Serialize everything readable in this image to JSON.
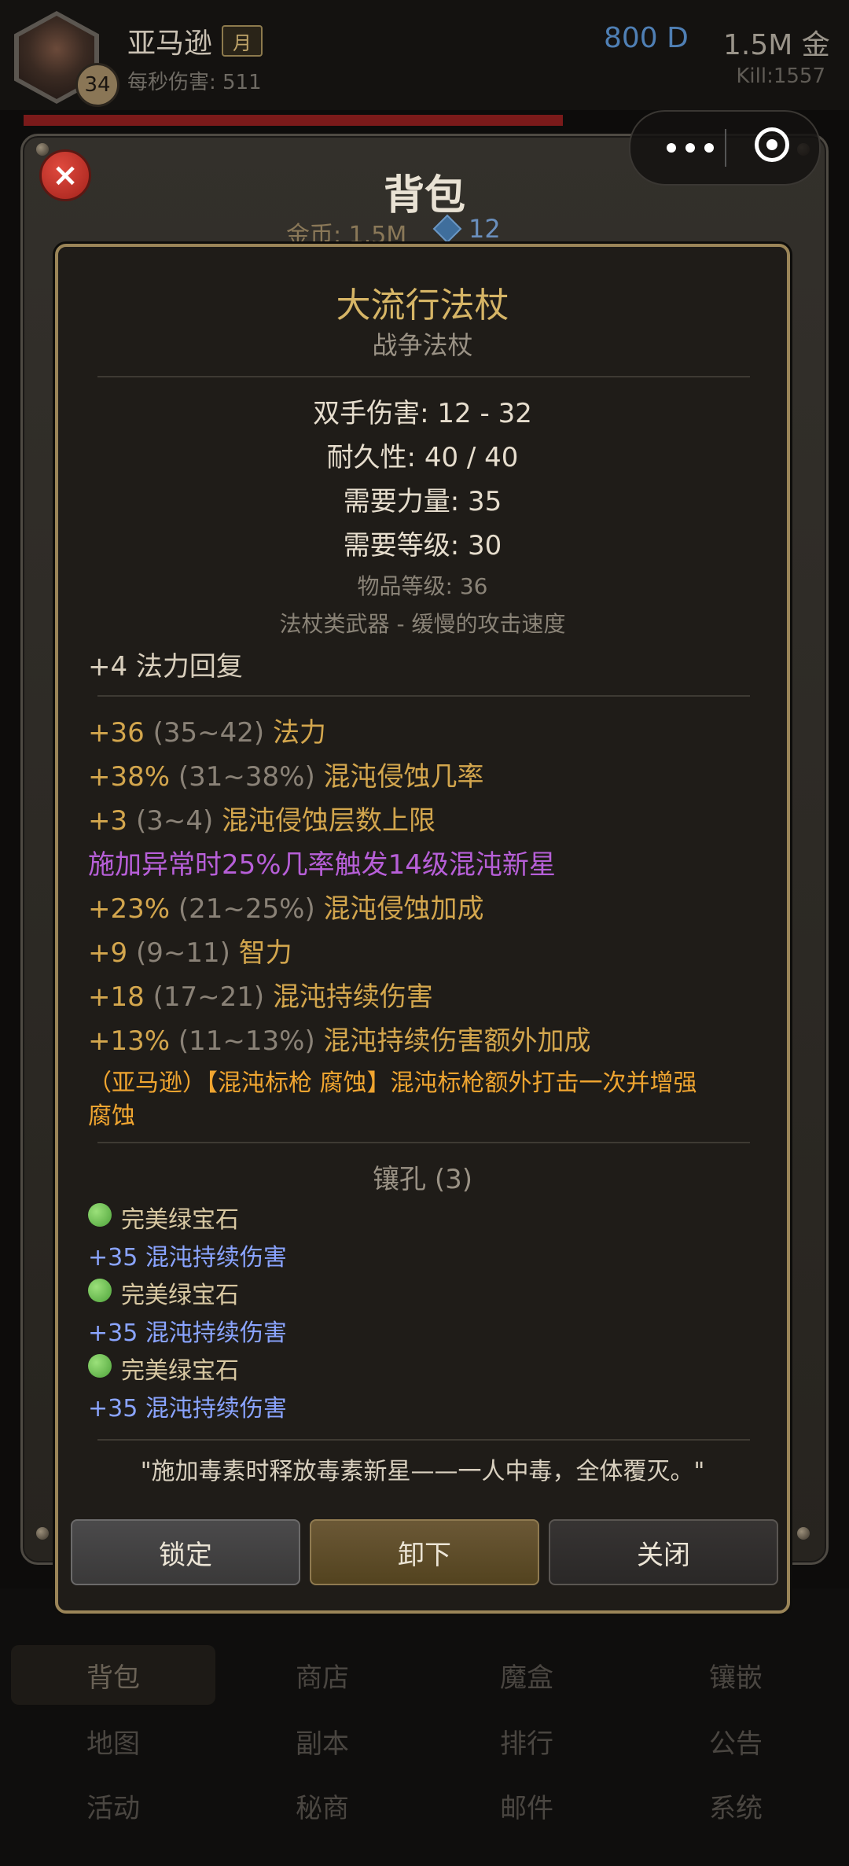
{
  "header": {
    "hero_name": "亚马逊",
    "month_badge": "月",
    "level": "34",
    "dps_label": "每秒伤害: 511",
    "diamonds": "800 D",
    "gold": "1.5M 金",
    "kills": "Kill:1557"
  },
  "bag": {
    "title": "背包",
    "gold_label": "金币: 1.5M",
    "gem_count": "12",
    "close_icon": "×"
  },
  "item": {
    "name": "大流行法杖",
    "type": "战争法杖",
    "two_hand_damage": "双手伤害: 12 - 32",
    "durability": "耐久性: 40 / 40",
    "req_str": "需要力量: 35",
    "req_level": "需要等级: 30",
    "item_level": "物品等级: 36",
    "weapon_class": "法杖类武器 - 缓慢的攻击速度",
    "implicit": "+4 法力回复",
    "affixes": [
      {
        "value": "+36",
        "range": "(35~42)",
        "name": "法力"
      },
      {
        "value": "+38%",
        "range": "(31~38%)",
        "name": "混沌侵蚀几率"
      },
      {
        "value": "+3",
        "range": "(3~4)",
        "name": "混沌侵蚀层数上限"
      },
      {
        "value": "+23%",
        "range": "(21~25%)",
        "name": "混沌侵蚀加成"
      },
      {
        "value": "+9",
        "range": "(9~11)",
        "name": "智力"
      },
      {
        "value": "+18",
        "range": "(17~21)",
        "name": "混沌持续伤害"
      },
      {
        "value": "+13%",
        "range": "(11~13%)",
        "name": "混沌持续伤害额外加成"
      }
    ],
    "proc_text": "施加异常时25%几率触发14级混沌新星",
    "skill_text_line1": "（亚马逊）【混沌标枪 腐蚀】混沌标枪额外打击一次并增强",
    "skill_text_line2": "腐蚀",
    "sockets_label": "镶孔 (3)",
    "sockets": [
      {
        "gem": "完美绿宝石",
        "bonus": "+35 混沌持续伤害"
      },
      {
        "gem": "完美绿宝石",
        "bonus": "+35 混沌持续伤害"
      },
      {
        "gem": "完美绿宝石",
        "bonus": "+35 混沌持续伤害"
      }
    ],
    "flavor": "\"施加毒素时释放毒素新星——一人中毒，全体覆灭。\""
  },
  "buttons": {
    "lock": "锁定",
    "unequip": "卸下",
    "close": "关闭"
  },
  "bottom_nav": {
    "row1": [
      "背包",
      "商店",
      "魔盒",
      "镶嵌"
    ],
    "row2": [
      "地图",
      "副本",
      "排行",
      "公告"
    ],
    "row3": [
      "活动",
      "秘商",
      "邮件",
      "系统"
    ]
  },
  "colors": {
    "item_name": "#d6b566",
    "affix_gold": "#d3a64d",
    "proc_purple": "#b75fd8",
    "skill_orange": "#f0a530",
    "socket_blue": "#8aa4ff",
    "frame_gold": "#9b8558"
  }
}
